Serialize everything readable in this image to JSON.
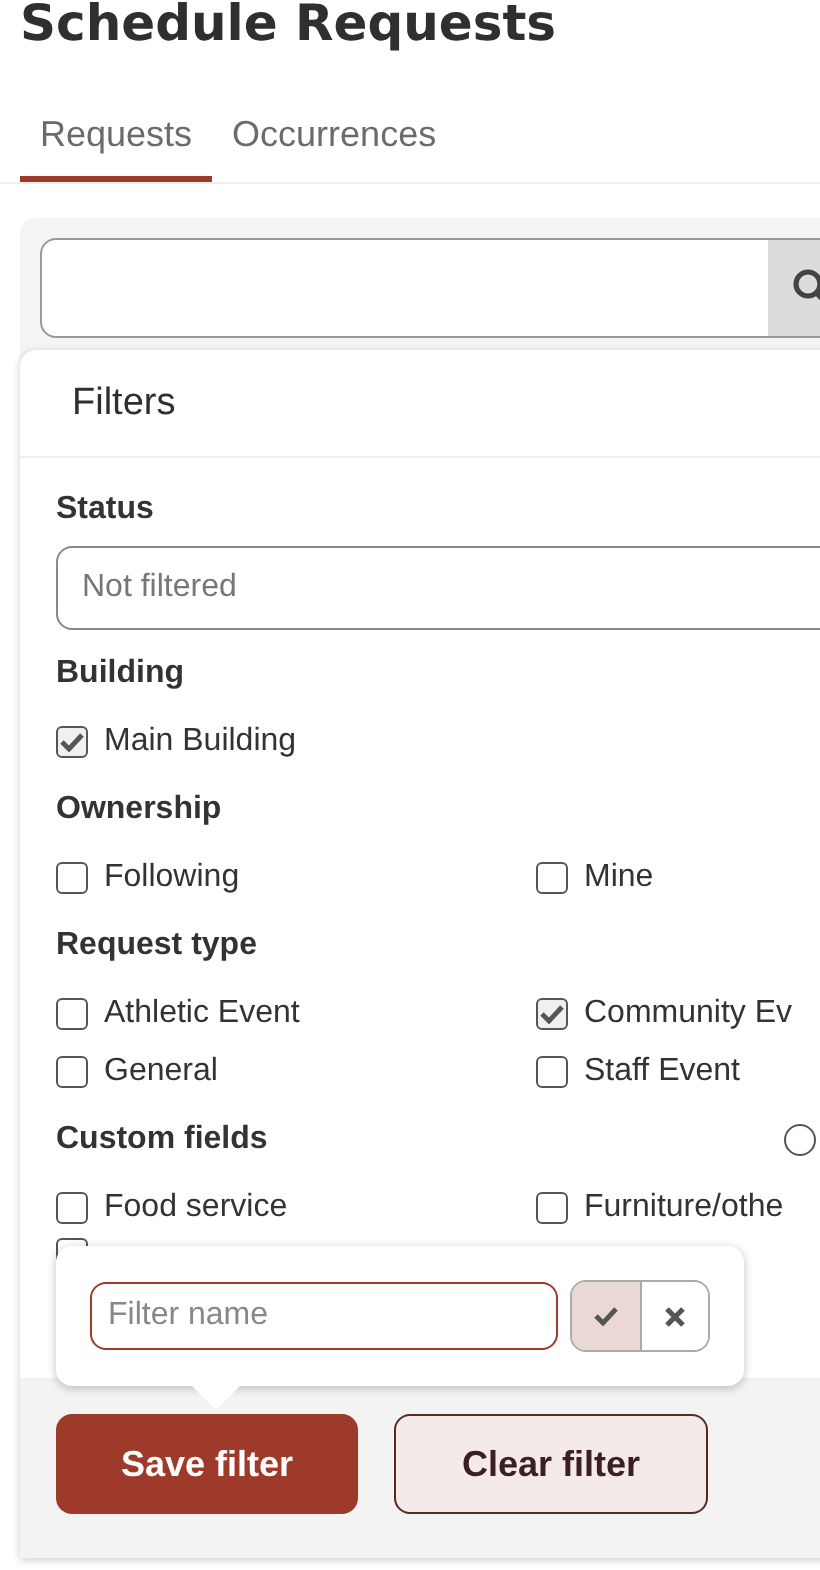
{
  "title": "Schedule Requests",
  "tabs": [
    {
      "label": "Requests",
      "selected": true
    },
    {
      "label": "Occurrences",
      "selected": false
    }
  ],
  "filters": {
    "title": "Filters",
    "status": {
      "label": "Status",
      "placeholder": "Not filtered"
    },
    "groups": [
      {
        "label": "Building",
        "options": [
          {
            "label": "Main Building",
            "checked": true
          }
        ]
      },
      {
        "label": "Ownership",
        "options": [
          {
            "label": "Following",
            "checked": false
          },
          {
            "label": "Mine",
            "checked": false
          }
        ]
      },
      {
        "label": "Request type",
        "options": [
          {
            "label": "Athletic Event",
            "checked": false
          },
          {
            "label": "Community Ev",
            "checked": true
          },
          {
            "label": "General",
            "checked": false
          },
          {
            "label": "Staff Event",
            "checked": false
          }
        ]
      },
      {
        "label": "Custom fields",
        "radio": {
          "selected": false
        },
        "options": [
          {
            "label": "Food service",
            "checked": false
          },
          {
            "label": "Furniture/othe",
            "checked": false
          }
        ]
      }
    ]
  },
  "hidden_option": {
    "checked": false
  },
  "save_popover": {
    "placeholder": "Filter name"
  },
  "buttons": [
    {
      "label": "Save filter",
      "kind": "primary"
    },
    {
      "label": "Clear filter",
      "kind": "secondary"
    }
  ]
}
